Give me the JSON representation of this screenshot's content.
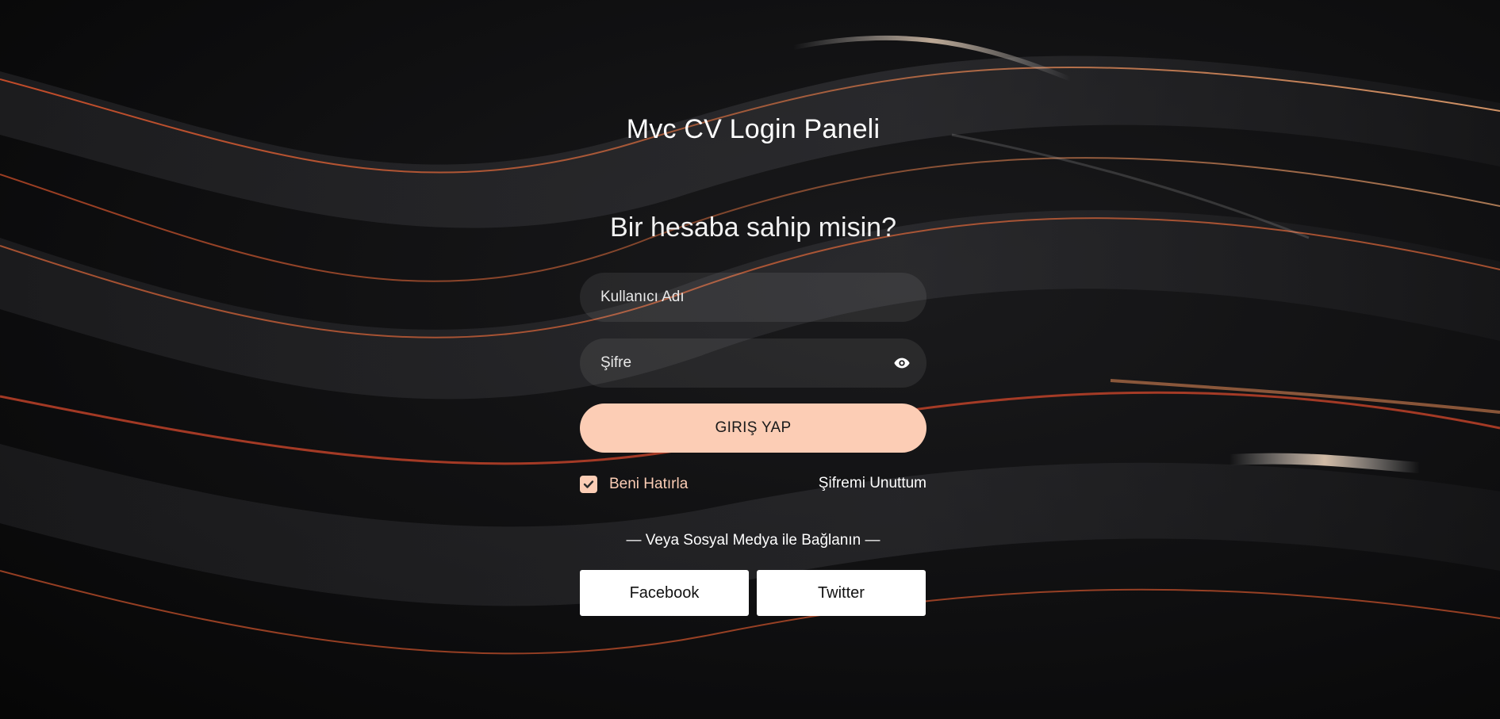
{
  "header": {
    "title": "Mvc CV Login Paneli",
    "subtitle": "Bir hesaba sahip misin?"
  },
  "form": {
    "username_placeholder": "Kullanıcı Adı",
    "username_value": "",
    "password_placeholder": "Şifre",
    "password_value": "",
    "password_toggle_icon": "eye-icon",
    "submit_label": "GIRIŞ YAP",
    "remember_label": "Beni Hatırla",
    "remember_checked": true,
    "forgot_label": "Şifremi Unuttum"
  },
  "social": {
    "divider_text": "— Veya Sosyal Medya ile Bağlanın —",
    "facebook_label": "Facebook",
    "twitter_label": "Twitter"
  },
  "colors": {
    "accent": "#fccdb5",
    "background": "#0c0c0d",
    "text": "#ffffff"
  }
}
